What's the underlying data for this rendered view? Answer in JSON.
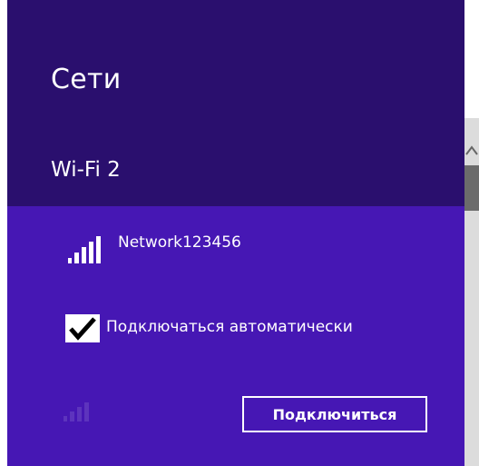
{
  "header": {
    "title": "Сети"
  },
  "wifi_section": {
    "title": "Wi-Fi 2"
  },
  "network": {
    "name": "Network123456",
    "signal_bars": 5,
    "auto_connect": {
      "label": "Подключаться автоматически",
      "checked": true
    },
    "connect_button_label": "Подключиться"
  },
  "colors": {
    "header_bg": "#2a0f6e",
    "card_bg": "#4617b4",
    "text": "#ffffff"
  },
  "icons": {
    "signal": "wifi-signal-icon",
    "check": "checkmark-icon",
    "scroll_up": "chevron-up-icon"
  }
}
